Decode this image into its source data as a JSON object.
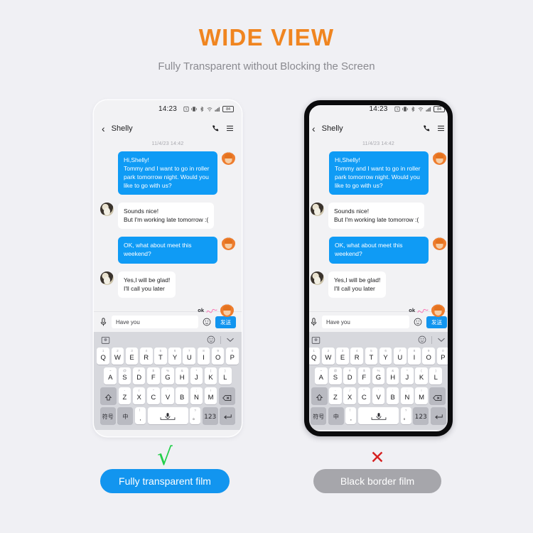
{
  "header": {
    "title": "WIDE VIEW",
    "subtitle": "Fully Transparent without Blocking the Screen",
    "title_color": "#f08520",
    "subtitle_color": "#8a8a90"
  },
  "phone": {
    "status_bar": {
      "time": "14:23",
      "battery_level": "84",
      "icons": [
        "alarm-icon",
        "vibrate-icon",
        "bluetooth-icon",
        "wifi-icon",
        "signal-icon",
        "battery-icon"
      ]
    },
    "nav": {
      "back": "‹",
      "contact_name": "Shelly",
      "call_icon": "phone-icon",
      "menu_icon": "menu-icon"
    },
    "chat": {
      "timestamp": "11/4/23 14:42",
      "messages": [
        {
          "side": "out",
          "text": "Hi,Shelly!\nTommy and I want to go in roller park tomorrow night. Would you like to go with us?"
        },
        {
          "side": "in",
          "text": "Sounds nice!\nBut I'm working late tomorrow :("
        },
        {
          "side": "out",
          "text": "OK, what about meet this weekend?"
        },
        {
          "side": "in",
          "text": "Yes,I will be glad!\nI'll call you later"
        }
      ],
      "sticker_label": "ok"
    },
    "input": {
      "mic_icon": "microphone-icon",
      "value": "Have you",
      "emoji_icon": "emoji-icon",
      "send_label": "发送"
    },
    "keyboard": {
      "toolbar": {
        "left_icon": "sticker-face-icon",
        "emoji_icon": "emoji-icon",
        "collapse_icon": "chevron-down-icon"
      },
      "row1": [
        {
          "k": "Q",
          "n": "1"
        },
        {
          "k": "W",
          "n": "2"
        },
        {
          "k": "E",
          "n": "3"
        },
        {
          "k": "R",
          "n": "4"
        },
        {
          "k": "T",
          "n": "5"
        },
        {
          "k": "Y",
          "n": "6"
        },
        {
          "k": "U",
          "n": "7"
        },
        {
          "k": "I",
          "n": "8"
        },
        {
          "k": "O",
          "n": "9"
        },
        {
          "k": "P",
          "n": "0"
        }
      ],
      "row2": [
        {
          "k": "A",
          "n": "~"
        },
        {
          "k": "S",
          "n": "@"
        },
        {
          "k": "D",
          "n": "#"
        },
        {
          "k": "F",
          "n": "$"
        },
        {
          "k": "G",
          "n": "%"
        },
        {
          "k": "H",
          "n": "&"
        },
        {
          "k": "J",
          "n": "*"
        },
        {
          "k": "K",
          "n": "("
        },
        {
          "k": "L",
          "n": ")"
        }
      ],
      "row3": [
        {
          "k": "Z",
          "n": "-"
        },
        {
          "k": "X",
          "n": "/"
        },
        {
          "k": "C",
          "n": "\""
        },
        {
          "k": "V",
          "n": "'"
        },
        {
          "k": "B",
          "n": ":"
        },
        {
          "k": "N",
          "n": ";"
        },
        {
          "k": "M",
          "n": "!"
        }
      ],
      "shift_icon": "shift-icon",
      "backspace_icon": "backspace-icon",
      "symbol_key": "符号",
      "lang_key": "中",
      "comma_key": ",",
      "comma_sup": "！",
      "space_icon": "microphone-icon",
      "period_key": "。",
      "period_sup": "?",
      "num_key": "123",
      "enter_icon": "enter-icon"
    }
  },
  "footer": {
    "left": {
      "mark": "check-mark",
      "mark_symbol": "√",
      "mark_color": "#23cf4a",
      "label": "Fully transparent film",
      "pill_color": "#1295ef"
    },
    "right": {
      "mark": "cross-mark",
      "mark_symbol": "✕",
      "mark_color": "#d62020",
      "label": "Black border film",
      "pill_color": "#a6a6ab"
    }
  }
}
